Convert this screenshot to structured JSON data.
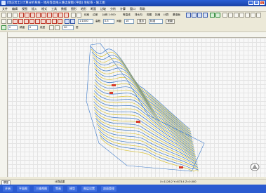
{
  "window": {
    "title": "[理正岩土] 计算分析系统 - 地形等高线三维边坡图 (平面)  坐标系 - 施工图",
    "buttons": [
      "_",
      "□",
      "×"
    ]
  },
  "menu": [
    "文件",
    "编辑",
    "视图",
    "插入",
    "格式",
    "工具",
    "数据",
    "图形",
    "地形",
    "断面",
    "边坡",
    "分析",
    "计算",
    "窗口",
    "帮助"
  ],
  "toolbar1": {
    "labels": [
      "线段",
      "边坡",
      "比例 1:500",
      "等高线",
      "排水沟",
      "视图",
      "挡墙",
      "计算",
      "基准面"
    ]
  },
  "toolbar2": {
    "fields": [
      "1:1000",
      "0.5",
      "10",
      "标准"
    ],
    "labels": [
      "高程",
      "间距",
      "显示",
      "刷新"
    ]
  },
  "toolbar3": {
    "fields": [
      "2",
      "0",
      "20"
    ],
    "labels": [
      "精度",
      "线型",
      "层"
    ]
  },
  "coordbar": {
    "cell": "模型",
    "label": "计算结果",
    "coords": "X=1126.2  Y=873.4  Z=0.000"
  },
  "status": [
    "开始",
    "平面图",
    "三维视图",
    "等高",
    "模型",
    "图层设置",
    "剖面管理"
  ],
  "colors": {
    "contour_yellow": "#d9c43a",
    "contour_blue": "#3a78c9",
    "marker_red": "#d83a2a",
    "titlebar": "#2a5fd6"
  }
}
